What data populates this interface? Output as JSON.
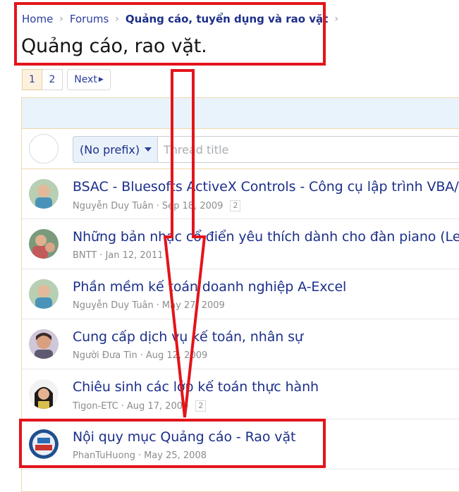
{
  "breadcrumb": {
    "items": [
      "Home",
      "Forums",
      "Quảng cáo, tuyển dụng và rao vặt"
    ]
  },
  "page_title": "Quảng cáo, rao vặt.",
  "pagination": {
    "pages": [
      "1",
      "2"
    ],
    "current": "1",
    "next_label": "Next"
  },
  "new_thread": {
    "prefix": "(No prefix)",
    "title_placeholder": "Thread title"
  },
  "threads": [
    {
      "title": "BSAC - Bluesofts ActiveX Controls - Công cụ lập trình VBA/VB",
      "author": "Nguyễn Duy Tuân",
      "date": "Sep 18, 2009",
      "pages": "2"
    },
    {
      "title": "Những bản nhạc cổ điển yêu thích dành cho đàn piano (Les C",
      "author": "BNTT",
      "date": "Jan 12, 2011",
      "pages": ""
    },
    {
      "title": "Phần mềm kế toán doanh nghiệp A-Excel",
      "author": "Nguyễn Duy Tuân",
      "date": "May 27, 2009",
      "pages": ""
    },
    {
      "title": "Cung cấp dịch vụ kế toán, nhân sự",
      "author": "Người Đưa Tin",
      "date": "Aug 12, 2009",
      "pages": ""
    },
    {
      "title": "Chiêu sinh các lớp kế toán thực hành",
      "author": "Tigon-ETC",
      "date": "Aug 17, 2009",
      "pages": "2"
    },
    {
      "title": "Nội quy mục Quảng cáo - Rao vặt",
      "author": "PhanTuHuong",
      "date": "May 25, 2008",
      "pages": ""
    }
  ],
  "colors": {
    "link": "#1c2f8a",
    "annotation": "#e3141b",
    "panel_head": "#e9f3fc",
    "border": "#f0d6ac"
  },
  "icons": {
    "breadcrumb_separator": "chevron-right-icon",
    "next": "caret-right-icon",
    "prefix": "caret-down-icon"
  }
}
